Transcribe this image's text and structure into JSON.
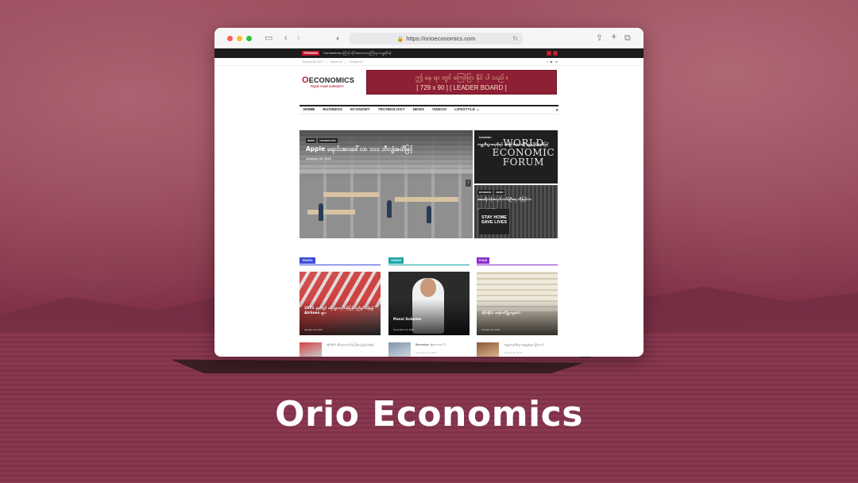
{
  "caption": "Orio Economics",
  "browser": {
    "url": "https://orioeconomics.com"
  },
  "ticker": {
    "tag": "TRENDING",
    "text": "Coronavirus ကြောင့် ထိုင်းအားကစားပွဲကြီးများ ရွှေ့ဆိုင်းခဲ့",
    "prev": "‹",
    "next": "›"
  },
  "topbar": {
    "date": "January 26, 2021",
    "links": [
      "About Us",
      "Contact Us"
    ],
    "social": [
      "f",
      "▶",
      "in"
    ]
  },
  "logo": {
    "name": "ECONOMICS",
    "tagline": "PIQUE YOUR CURIOSITY"
  },
  "leaderboard": {
    "line1": "ဤ နေ ရာ တွင် ကြော်ငြာ နိုင် ပါ သည် ။",
    "line2": "[ 729 x 90 ] [ LEADER BOARD ]"
  },
  "nav": {
    "items": [
      "HOME",
      "BUSINESS",
      "ECONOMY",
      "TECHNOLOGY",
      "NEWS",
      "VIDEOS",
      "LIFESTYLE ⌄"
    ]
  },
  "hero": {
    "tags": [
      "NEWS",
      "TECHNOLOGY"
    ],
    "title": "Apple ရောင်းအားဒေါ်လာ ၁၁၁ ဘီလျံအထိမြင့်",
    "date": "January 28, 2021"
  },
  "side_posts": [
    {
      "tags": [
        "ECONOMY"
      ],
      "title": "ကမ္ဘာ့စီးပွားရေးဖိုရမ် အစည်းအဝေးကို အွန်လိုင်းစနစ်ဖြင့်",
      "logo_text": "WORLD\nECONOMIC\nFORUM"
    },
    {
      "tags": [
        "BUSINESS",
        "NEWS"
      ],
      "title": "အမေရိကန်အလုပ်လက်မဲ့ဦးရေ တိုးမြင့်လာ",
      "date": "January 26, 2021",
      "poster": "STAY HOME\nSAVE LIVES"
    }
  ],
  "sections": [
    {
      "label": "TRAVEL",
      "color": "#3b4bd8"
    },
    {
      "label": "VIDEOS",
      "color": "#1aa6a6"
    },
    {
      "label": "FOOD",
      "color": "#8b2fc9"
    }
  ],
  "cards": [
    {
      "title": "2021 ခုနှစ်တွင် ခရီးသွားလုပ်ငန်းပြန်လည်ရှင်သန်ရန် Airlines များ",
      "date": "January 26, 2021"
    },
    {
      "title": "Ponzi Scheme",
      "date": "November 14, 2020"
    },
    {
      "title": "ထိုင်းနိုင်ငံ ဆန်တင်ပို့မှုကျဆင်း",
      "date": "January 22, 2021"
    }
  ],
  "minis": [
    {
      "title": "ထိုင်းနိုင်ငံ ခရီးသွားလုပ်ငန်း ပြန်လည်ဖွင့်လှစ်ရန်",
      "date": ""
    },
    {
      "title": "Recession ဆိုတာဘာလဲ ?",
      "date": "November 16, 2020"
    },
    {
      "title": "ကမ္ဘာ့စားနပ်ရိက္ခာ စျေးနှုန်းများ မြင့်တက်",
      "date": "January 20, 2021"
    }
  ],
  "colors": {
    "brand": "#b01e36",
    "leaderboard": "#8f1f34"
  }
}
